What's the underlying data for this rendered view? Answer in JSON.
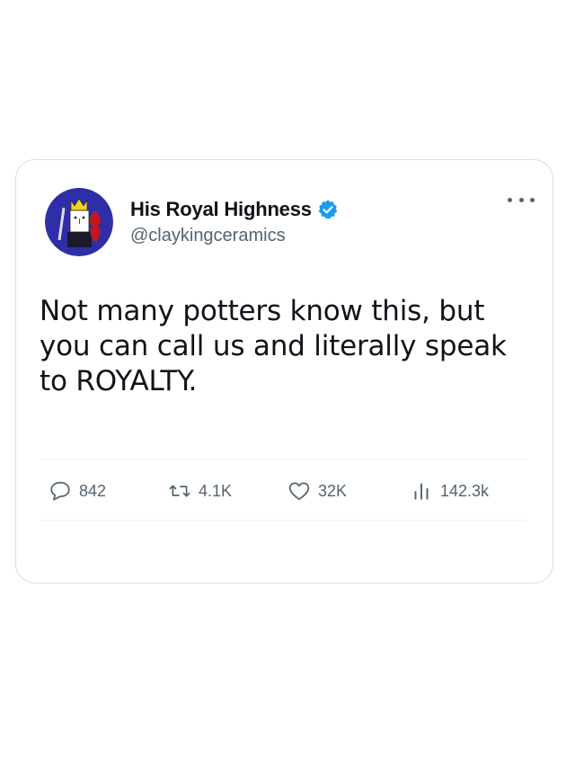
{
  "tweet": {
    "author": {
      "display_name": "His Royal Highness",
      "handle": "@claykingceramics",
      "verified": true,
      "avatar_icon": "king-potter-avatar"
    },
    "text": "Not many potters know this, but you can call us and literally speak to ROYALTY.",
    "more_icon": "more-dots-icon",
    "stats": {
      "replies": "842",
      "retweets": "4.1K",
      "likes": "32K",
      "views": "142.3k"
    }
  },
  "colors": {
    "text": "#0f1419",
    "secondary": "#536471",
    "verified": "#1d9bf0",
    "border": "#d9dde1",
    "avatar_bg": "#2e2ea8",
    "crown": "#f5d21a",
    "vase": "#c4161c"
  }
}
